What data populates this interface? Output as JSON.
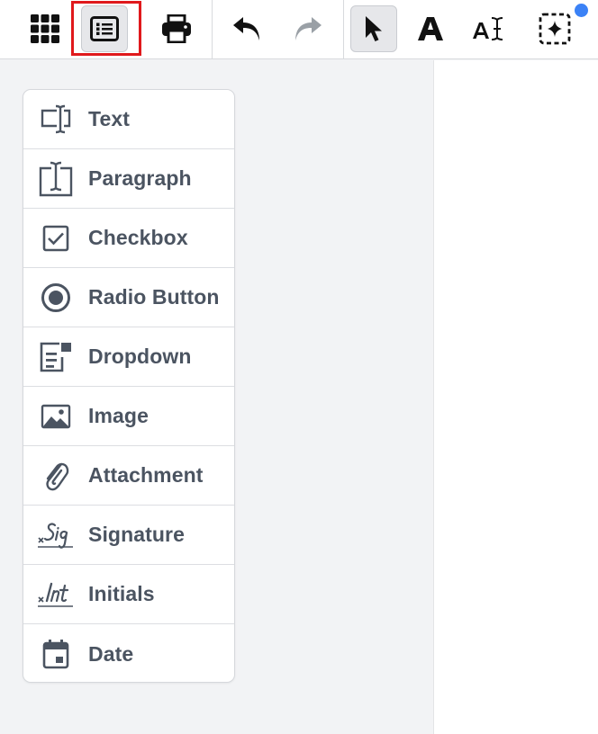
{
  "toolbar": {
    "buttons": [
      {
        "name": "apps-grid-button",
        "icon": "grid-icon"
      },
      {
        "name": "field-list-button",
        "icon": "list-icon",
        "highlighted": true
      },
      {
        "name": "print-button",
        "icon": "printer-icon"
      },
      {
        "name": "undo-button",
        "icon": "undo-icon"
      },
      {
        "name": "redo-button",
        "icon": "redo-icon",
        "disabled": true
      },
      {
        "name": "select-tool-button",
        "icon": "cursor-arrow-icon",
        "active": true
      },
      {
        "name": "text-tool-button",
        "icon": "letter-a-icon"
      },
      {
        "name": "text-field-tool-button",
        "icon": "text-cursor-icon"
      },
      {
        "name": "ai-tool-button",
        "icon": "sparkle-selection-icon",
        "has_notification": true
      }
    ],
    "highlight_color": "#e0191c",
    "notification_color": "#3b82f6"
  },
  "fields": {
    "items": [
      {
        "label": "Text",
        "icon": "text-field-icon"
      },
      {
        "label": "Paragraph",
        "icon": "paragraph-field-icon"
      },
      {
        "label": "Checkbox",
        "icon": "checkbox-icon"
      },
      {
        "label": "Radio Button",
        "icon": "radio-button-icon"
      },
      {
        "label": "Dropdown",
        "icon": "dropdown-icon"
      },
      {
        "label": "Image",
        "icon": "image-icon"
      },
      {
        "label": "Attachment",
        "icon": "paperclip-icon"
      },
      {
        "label": "Signature",
        "icon": "signature-icon"
      },
      {
        "label": "Initials",
        "icon": "initials-icon"
      },
      {
        "label": "Date",
        "icon": "calendar-icon"
      }
    ]
  }
}
